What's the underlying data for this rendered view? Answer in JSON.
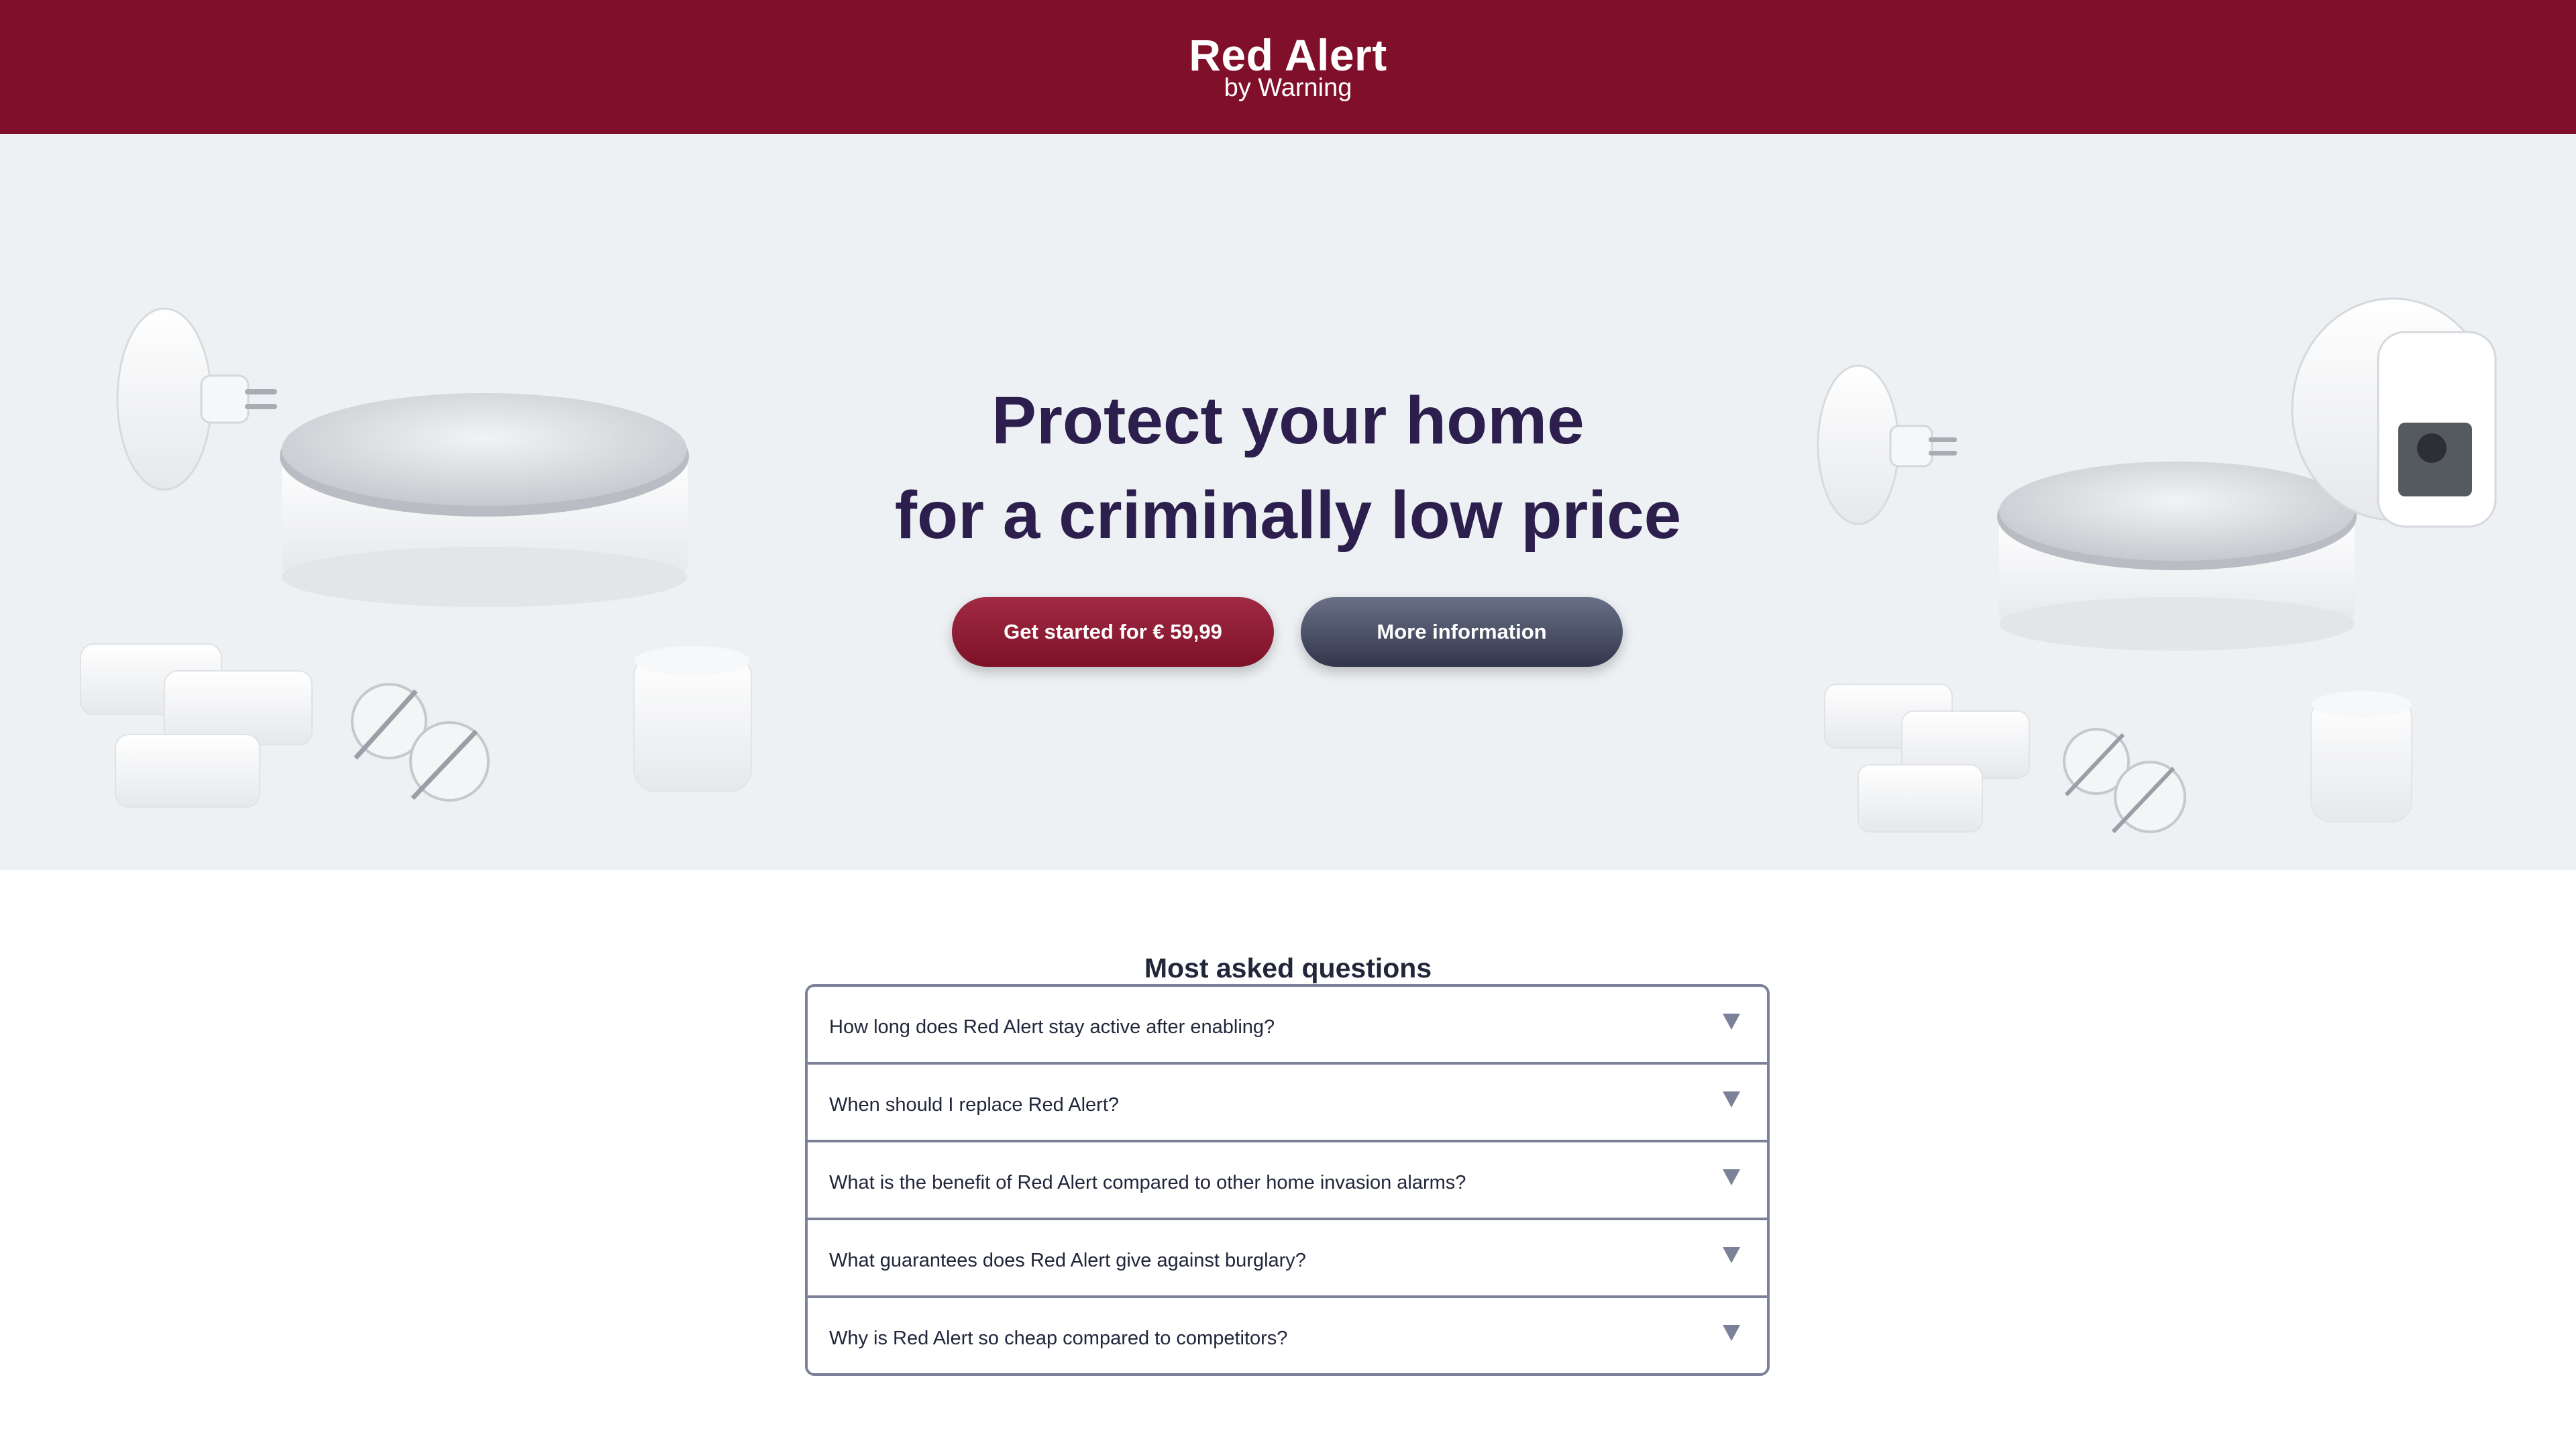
{
  "header": {
    "title": "Red Alert",
    "subtitle": "by Warning",
    "background_color": "#800f29"
  },
  "hero": {
    "headline": "Protect your home",
    "subline": "for a criminally low price",
    "primary_button": "Get started for € 59,99",
    "secondary_button": "More information",
    "product_images": [
      "home-alarm-kit-image",
      "home-alarm-kit-with-camera-image"
    ]
  },
  "faq": {
    "title": "Most asked questions",
    "items": [
      {
        "question": "How long does Red Alert stay active after enabling?"
      },
      {
        "question": "When should I replace Red Alert?"
      },
      {
        "question": "What is the benefit of Red Alert compared to other home invasion alarms?"
      },
      {
        "question": "What guarantees does Red Alert give against burglary?"
      },
      {
        "question": "Why is Red Alert so cheap compared to competitors?"
      }
    ]
  },
  "colors": {
    "brand": "#800f29",
    "hero_background": "#edf1f3",
    "headline_text": "#2d1f4d",
    "secondary_button": "#3c4157",
    "faq_border": "#7b8196"
  }
}
